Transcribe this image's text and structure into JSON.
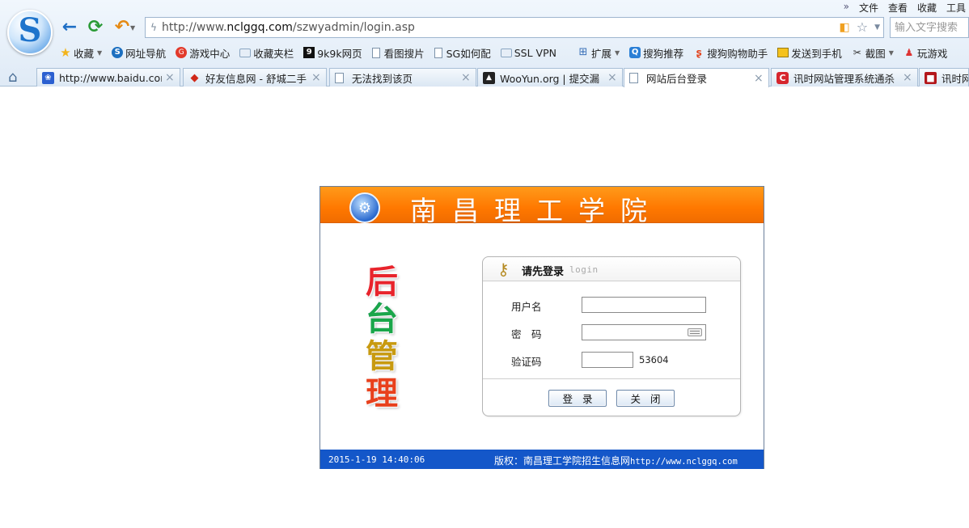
{
  "browser": {
    "logo_letter": "S",
    "menu": {
      "overflow": "»",
      "items": [
        "文件",
        "查看",
        "收藏",
        "工具"
      ]
    },
    "address": {
      "prefix": "http://www.",
      "host": "nclggq.com",
      "path": "/szwyadmin/login.asp"
    },
    "search": {
      "placeholder": "输入文字搜索"
    },
    "bookmarks": [
      {
        "label": "收藏",
        "icon": "star-icon"
      },
      {
        "label": "网址导航",
        "icon": "s-logo-icon"
      },
      {
        "label": "游戏中心",
        "icon": "game-icon"
      },
      {
        "label": "收藏夹栏",
        "icon": "folder-icon"
      },
      {
        "label": "9k9k网页",
        "icon": "9k-icon"
      },
      {
        "label": "看图搜片",
        "icon": "page-icon"
      },
      {
        "label": "SG如何配",
        "icon": "page-icon"
      },
      {
        "label": "SSL VPN",
        "icon": "folder-icon"
      },
      {
        "label": "扩展",
        "icon": "grid-icon"
      },
      {
        "label": "搜狗推荐",
        "icon": "sogou-icon"
      },
      {
        "label": "搜狗购物助手",
        "icon": "shopping-icon"
      },
      {
        "label": "发送到手机",
        "icon": "phone-icon"
      },
      {
        "label": "截图",
        "icon": "scissors-icon"
      },
      {
        "label": "玩游戏",
        "icon": "play-icon"
      }
    ],
    "tabs": [
      {
        "title": "http://www.baidu.com",
        "icon": "baidu-paw-icon"
      },
      {
        "title": "好友信息网 - 舒城二手",
        "icon": "haoyou-icon"
      },
      {
        "title": "无法找到该页",
        "icon": "page-icon"
      },
      {
        "title": "WooYun.org | 提交漏",
        "icon": "wooyun-icon"
      },
      {
        "title": "网站后台登录",
        "icon": "page-icon"
      },
      {
        "title": "讯时网站管理系统通杀",
        "icon": "xunshi-icon"
      },
      {
        "title": "讯时网",
        "icon": "xunshi-icon"
      }
    ],
    "close_glyph": "×"
  },
  "page": {
    "school_name": "南昌理工学院",
    "side_text": [
      "后",
      "台",
      "管",
      "理"
    ],
    "login": {
      "title": "请先登录",
      "subtitle": "login",
      "username_label": "用户名",
      "password_label": "密　码",
      "captcha_label": "验证码",
      "captcha_code": "53604",
      "submit_label": "登录",
      "close_label": "关闭"
    },
    "footer": {
      "datetime": "2015-1-19 14:40:06",
      "copyright": "版权：南昌理工学院招生信息网",
      "url": "http://www.nclggq.com"
    }
  }
}
